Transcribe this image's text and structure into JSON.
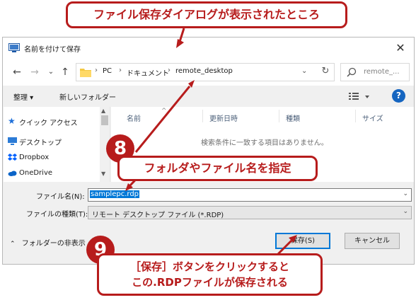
{
  "window": {
    "title": "名前を付けて保存",
    "close_glyph": "✕"
  },
  "address": {
    "crumbs": [
      "PC",
      "ドキュメント",
      "remote_desktop"
    ],
    "separator": "›",
    "search_placeholder": "remote_..."
  },
  "toolbar": {
    "organize": "整理 ▾",
    "new_folder": "新しいフォルダー"
  },
  "nav_pane": {
    "items": [
      {
        "label": "クイック アクセス",
        "icon": "star-icon"
      },
      {
        "label": "デスクトップ",
        "icon": "desktop-icon"
      },
      {
        "label": "Dropbox",
        "icon": "dropbox-icon"
      },
      {
        "label": "OneDrive",
        "icon": "onedrive-icon"
      }
    ]
  },
  "file_pane": {
    "columns": [
      "名前",
      "更新日時",
      "種類",
      "サイズ"
    ],
    "empty_message": "検索条件に一致する項目はありません。"
  },
  "form": {
    "filename_label": "ファイル名(N):",
    "filename_value": "samplepc.rdp",
    "filetype_label": "ファイルの種類(T):",
    "filetype_value": "リモート デスクトップ ファイル (*.RDP)"
  },
  "footer": {
    "hide_folders": "フォルダーの非表示",
    "save": "保存(S)",
    "cancel": "キャンセル"
  },
  "annotations": {
    "top_caption": "ファイル保存ダイアログが表示されたところ",
    "step8_number": "8",
    "step8_caption": "フォルダやファイル名を指定",
    "step9_number": "9",
    "step9_line1": "［保存］ボタンをクリックすると",
    "step9_line2": "この.RDPファイルが保存される"
  },
  "colors": {
    "accent": "#0078d7",
    "callout": "#b71c1c"
  }
}
